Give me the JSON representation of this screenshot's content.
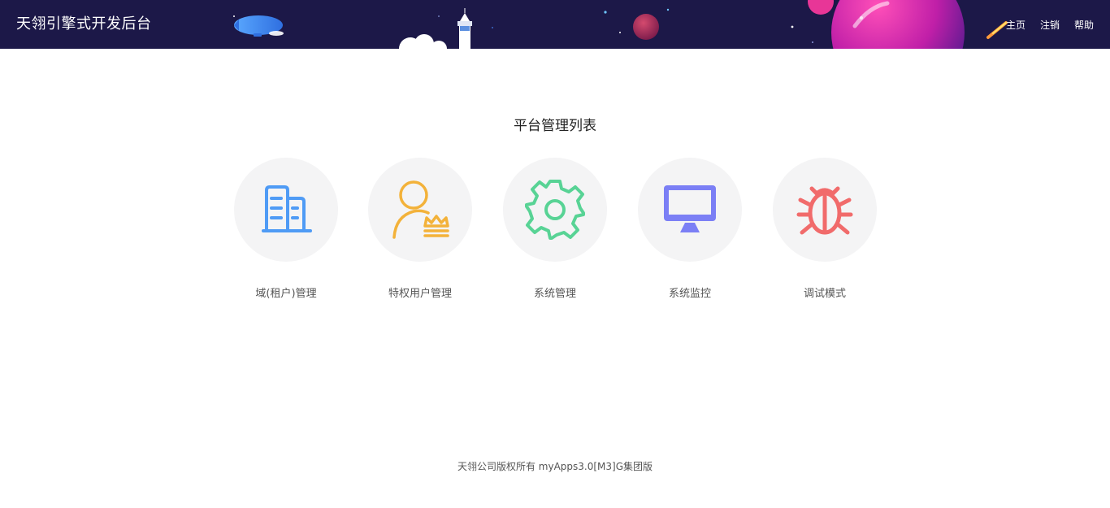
{
  "header": {
    "title": "天翎引擎式开发后台",
    "nav": {
      "home": "主页",
      "logout": "注销",
      "help": "帮助"
    }
  },
  "main": {
    "section_title": "平台管理列表",
    "modules": [
      {
        "label": "域(租户)管理",
        "icon": "building-icon",
        "color": "#4f9bf5"
      },
      {
        "label": "特权用户管理",
        "icon": "user-crown-icon",
        "color": "#f3b23a"
      },
      {
        "label": "系统管理",
        "icon": "gear-icon",
        "color": "#58d395"
      },
      {
        "label": "系统监控",
        "icon": "monitor-icon",
        "color": "#7b7ff5"
      },
      {
        "label": "调试模式",
        "icon": "bug-icon",
        "color": "#f16b6b"
      }
    ]
  },
  "footer": {
    "copyright": "天翎公司版权所有 myApps3.0[M3]G集团版"
  },
  "colors": {
    "header_bg": "#1c1848",
    "module_bg": "#f4f4f5"
  }
}
